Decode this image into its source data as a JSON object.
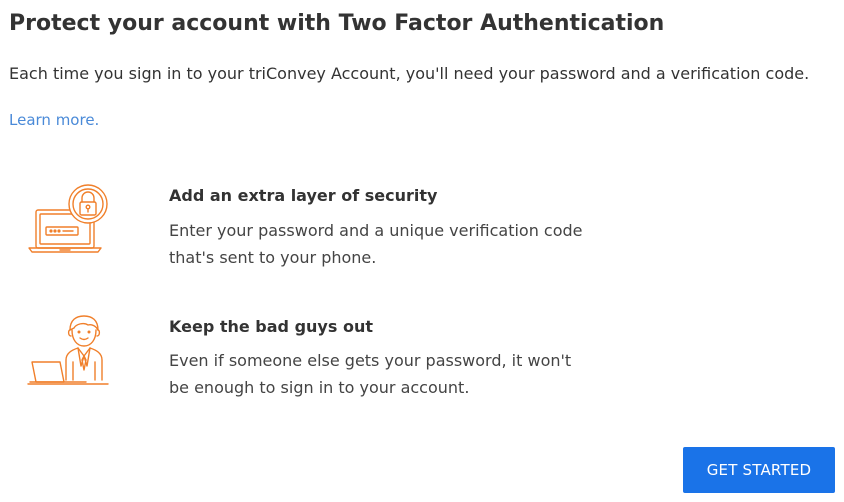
{
  "header": {
    "title": "Protect your account with Two Factor Authentication",
    "intro": "Each time you sign in to your triConvey Account, you'll need your password and a verification code.",
    "learn_more": "Learn more."
  },
  "features": [
    {
      "icon": "laptop-lock-icon",
      "heading": "Add an extra layer of security",
      "lines": [
        "Enter your password and a unique verification code",
        "that's sent to your phone."
      ]
    },
    {
      "icon": "businessman-laptop-icon",
      "heading": "Keep the bad guys out",
      "lines": [
        "Even if someone else gets your password, it won't",
        "be enough to sign in to your account."
      ]
    }
  ],
  "actions": {
    "get_started": "GET STARTED"
  },
  "colors": {
    "accent": "#1a73e8",
    "link": "#4a8ad8",
    "icon": "#f07f2a",
    "text": "#333333"
  }
}
